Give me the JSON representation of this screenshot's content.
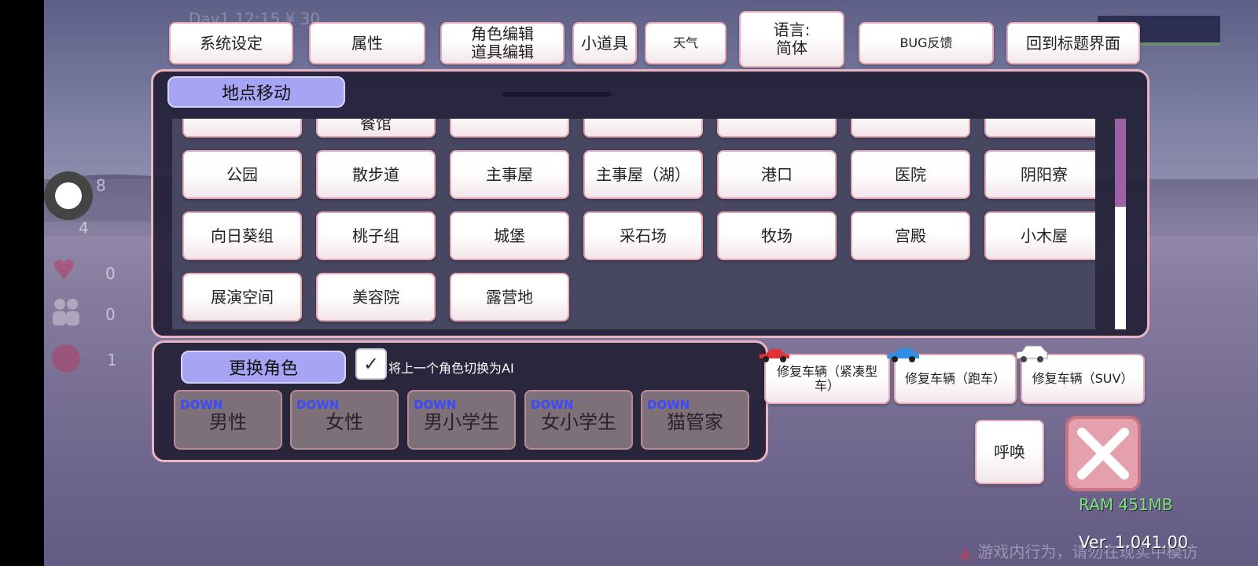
{
  "hud": {
    "datetime": "Day1 12:15 ¥ 30"
  },
  "top_buttons": {
    "system_settings": "系统设定",
    "attributes": "属性",
    "character_edit": "角色编辑",
    "item_edit": "道具编辑",
    "gadgets": "小道具",
    "weather": "天气",
    "language": "语言:",
    "language_value": "简体",
    "bug_feedback": "BUG反馈",
    "back_to_title": "回到标题界面"
  },
  "location_panel": {
    "title": "地点移动",
    "partial_row": [
      "",
      "餐馆",
      "",
      "",
      "",
      "",
      ""
    ],
    "locations": [
      [
        "公园",
        "散步道",
        "主事屋",
        "主事屋（湖）",
        "港口",
        "医院",
        "阴阳寮"
      ],
      [
        "向日葵组",
        "桃子组",
        "城堡",
        "采石场",
        "牧场",
        "宫殿",
        "小木屋"
      ],
      [
        "展演空间",
        "美容院",
        "露营地"
      ]
    ]
  },
  "character_panel": {
    "title": "更换角色",
    "switch_ai_label": "将上一个角色切换为AI",
    "switch_ai_checked": true,
    "down_label": "DOWN",
    "characters": [
      "男性",
      "女性",
      "男小学生",
      "女小学生",
      "猫管家"
    ]
  },
  "vehicles": {
    "compact": "修复车辆（紧凑型车）",
    "sports": "修复车辆（跑车）",
    "suv": "修复车辆（SUV）",
    "colors": {
      "compact": "#e0303a",
      "sports": "#2f8fe6",
      "suv": "#ffffff"
    }
  },
  "summon": "呼唤",
  "side_stats": [
    "8",
    "4",
    "0",
    "0",
    "1"
  ],
  "ram": "RAM 451MB",
  "version": "Ver. 1.041.00",
  "warning": "游戏内行为，请勿在现实中模仿",
  "icons": [
    "heart-icon",
    "people-icon",
    "sad-face-icon",
    "close-icon",
    "car-icon",
    "check-icon",
    "warning-icon"
  ]
}
